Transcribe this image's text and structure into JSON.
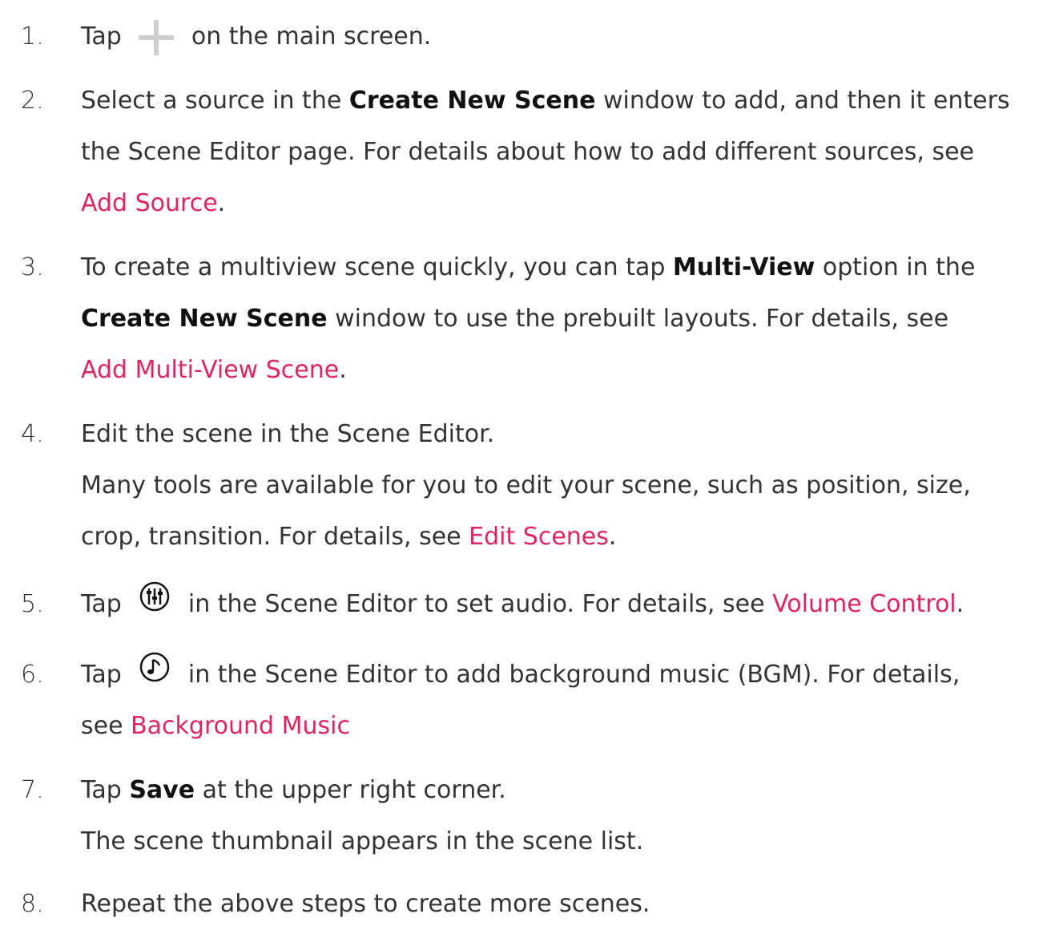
{
  "accent_link_color": "#e0245e",
  "steps": [
    {
      "num": "1.",
      "a": "Tap ",
      "icon": "plus-icon",
      "b": " on the main screen."
    },
    {
      "num": "2.",
      "l1a": "Select a source in the ",
      "l1b": "Create New Scene",
      "l1c": " window to add, and then it enters",
      "l2": "the Scene Editor page. For details about how to add different sources, see",
      "link": "Add Source",
      "end": "."
    },
    {
      "num": "3.",
      "l1a": "To create a multiview scene quickly, you can tap ",
      "l1b": "Multi-View",
      "l1c": " option in the",
      "l2a": "Create New Scene",
      "l2b": " window to use the prebuilt layouts. For details, see",
      "link": "Add Multi-View Scene",
      "end": "."
    },
    {
      "num": "4.",
      "l1": "Edit the scene in the Scene Editor.",
      "l2": "Many tools are available for you to edit your scene, such as position, size,",
      "l3a": "crop, transition. For details, see ",
      "link": "Edit Scenes",
      "end": "."
    },
    {
      "num": "5.",
      "a": "Tap ",
      "icon": "audio-mixer-icon",
      "b": " in the Scene Editor to set audio. For details, see ",
      "link": "Volume Control",
      "end": "."
    },
    {
      "num": "6.",
      "a": "Tap ",
      "icon": "music-note-icon",
      "b": " in the Scene Editor to add background music (BGM). For details,",
      "l2": "see ",
      "link": "Background Music"
    },
    {
      "num": "7.",
      "a": "Tap ",
      "bold": "Save",
      "b": " at the upper right corner.",
      "l2": "The scene thumbnail appears in the scene list."
    },
    {
      "num": "8.",
      "l1": "Repeat the above steps to create more scenes."
    }
  ]
}
